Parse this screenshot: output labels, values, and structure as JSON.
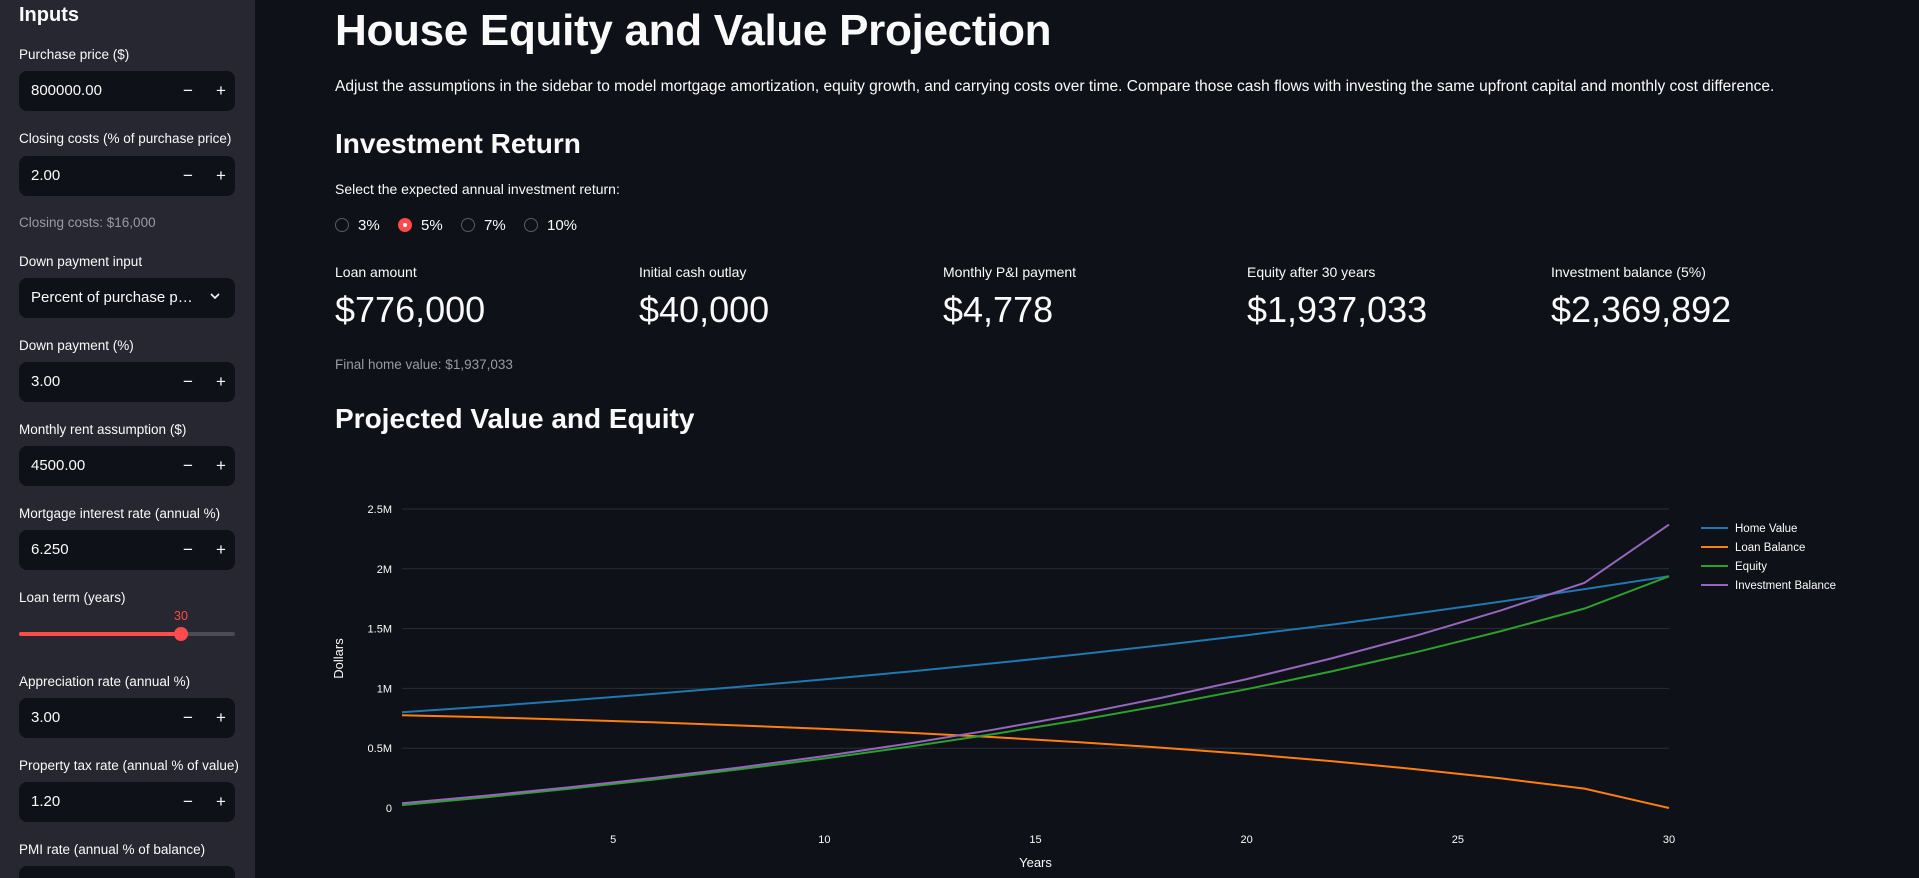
{
  "sidebar": {
    "title": "Inputs",
    "purchase_price": {
      "label": "Purchase price ($)",
      "value": "800000.00"
    },
    "closing_costs": {
      "label": "Closing costs (% of purchase price)",
      "value": "2.00"
    },
    "closing_caption": "Closing costs: $16,000",
    "down_payment_input": {
      "label": "Down payment input",
      "value": "Percent of purchase price"
    },
    "down_payment": {
      "label": "Down payment (%)",
      "value": "3.00"
    },
    "rent": {
      "label": "Monthly rent assumption ($)",
      "value": "4500.00"
    },
    "interest": {
      "label": "Mortgage interest rate (annual %)",
      "value": "6.250"
    },
    "loan_term": {
      "label": "Loan term (years)",
      "value": "30",
      "min": 0,
      "max": 40
    },
    "appreciation": {
      "label": "Appreciation rate (annual %)",
      "value": "3.00"
    },
    "property_tax": {
      "label": "Property tax rate (annual % of value)",
      "value": "1.20"
    },
    "pmi": {
      "label": "PMI rate (annual % of balance)"
    },
    "minus": "−",
    "plus": "+"
  },
  "main": {
    "title": "House Equity and Value Projection",
    "description": "Adjust the assumptions in the sidebar to model mortgage amortization, equity growth, and carrying costs over time. Compare those cash flows with investing the same upfront capital and monthly cost difference.",
    "investment_heading": "Investment Return",
    "radio_prompt": "Select the expected annual investment return:",
    "radio_options": [
      "3%",
      "5%",
      "7%",
      "10%"
    ],
    "radio_selected": "5%",
    "metrics": [
      {
        "label": "Loan amount",
        "value": "$776,000"
      },
      {
        "label": "Initial cash outlay",
        "value": "$40,000"
      },
      {
        "label": "Monthly P&I payment",
        "value": "$4,778"
      },
      {
        "label": "Equity after 30 years",
        "value": "$1,937,033"
      },
      {
        "label": "Investment balance (5%)",
        "value": "$2,369,892"
      }
    ],
    "final_home_value": "Final home value: $1,937,033",
    "chart_heading": "Projected Value and Equity"
  },
  "chart_data": {
    "type": "line",
    "xlabel": "Years",
    "ylabel": "Dollars",
    "xlim": [
      0,
      30
    ],
    "ylim": [
      0,
      2500000
    ],
    "x_ticks": [
      5,
      10,
      15,
      20,
      25,
      30
    ],
    "y_ticks": [
      {
        "v": 0,
        "t": "0"
      },
      {
        "v": 500000,
        "t": "0.5M"
      },
      {
        "v": 1000000,
        "t": "1M"
      },
      {
        "v": 1500000,
        "t": "1.5M"
      },
      {
        "v": 2000000,
        "t": "2M"
      },
      {
        "v": 2500000,
        "t": "2.5M"
      }
    ],
    "grid": true,
    "legend_position": "right",
    "x": [
      0,
      2,
      4,
      6,
      8,
      10,
      12,
      14,
      16,
      18,
      20,
      22,
      24,
      26,
      28,
      30
    ],
    "series": [
      {
        "name": "Home Value",
        "color": "#1f77b4",
        "values": [
          800000,
          848720,
          900410,
          955240,
          1013420,
          1075130,
          1140610,
          1210070,
          1283770,
          1361950,
          1444890,
          1532880,
          1626240,
          1725280,
          1830350,
          1937033
        ]
      },
      {
        "name": "Loan Balance",
        "color": "#ff7f0e",
        "values": [
          776000,
          758400,
          738400,
          715800,
          690200,
          661500,
          629100,
          592400,
          551000,
          504100,
          451400,
          391800,
          324400,
          248400,
          162600,
          0
        ]
      },
      {
        "name": "Equity",
        "color": "#2ca02c",
        "values": [
          24000,
          90300,
          162000,
          239400,
          323200,
          413600,
          511500,
          617700,
          732800,
          857900,
          993500,
          1141100,
          1301800,
          1476900,
          1667800,
          1937033
        ]
      },
      {
        "name": "Investment Balance",
        "color": "#9467bd",
        "values": [
          40000,
          104000,
          175000,
          253000,
          339000,
          434000,
          539000,
          655000,
          782000,
          923000,
          1078000,
          1250000,
          1440000,
          1650000,
          1883000,
          2369892
        ]
      }
    ]
  }
}
